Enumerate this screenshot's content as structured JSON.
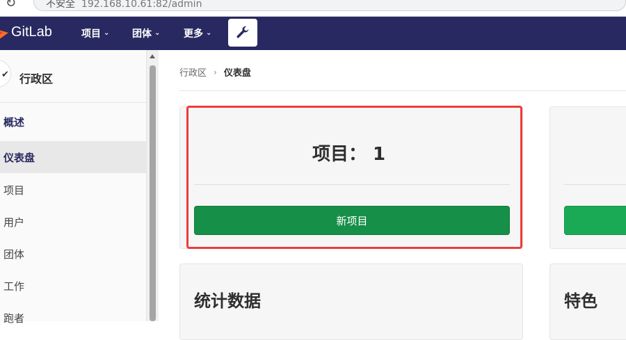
{
  "browser": {
    "security_label": "不安全",
    "address_text": "192.168.10.61:82/admin"
  },
  "topnav": {
    "brand": "GitLab",
    "menus": [
      {
        "label": "项目"
      },
      {
        "label": "团体"
      },
      {
        "label": "更多"
      }
    ],
    "accent_color": "#292961"
  },
  "sidebar": {
    "title": "行政区",
    "items": [
      {
        "label": "概述"
      },
      {
        "label": "仪表盘"
      },
      {
        "label": "项目"
      },
      {
        "label": "用户"
      },
      {
        "label": "团体"
      },
      {
        "label": "工作"
      },
      {
        "label": "跑者"
      }
    ]
  },
  "breadcrumb": {
    "parent": "行政区",
    "current": "仪表盘"
  },
  "cards": {
    "projects": {
      "title": "项目： 1",
      "button": "新项目"
    },
    "stats": {
      "title": "统计数据"
    },
    "features": {
      "title": "特色"
    }
  },
  "colors": {
    "button_green": "#168f48",
    "highlight_red": "#ee3b3b"
  }
}
